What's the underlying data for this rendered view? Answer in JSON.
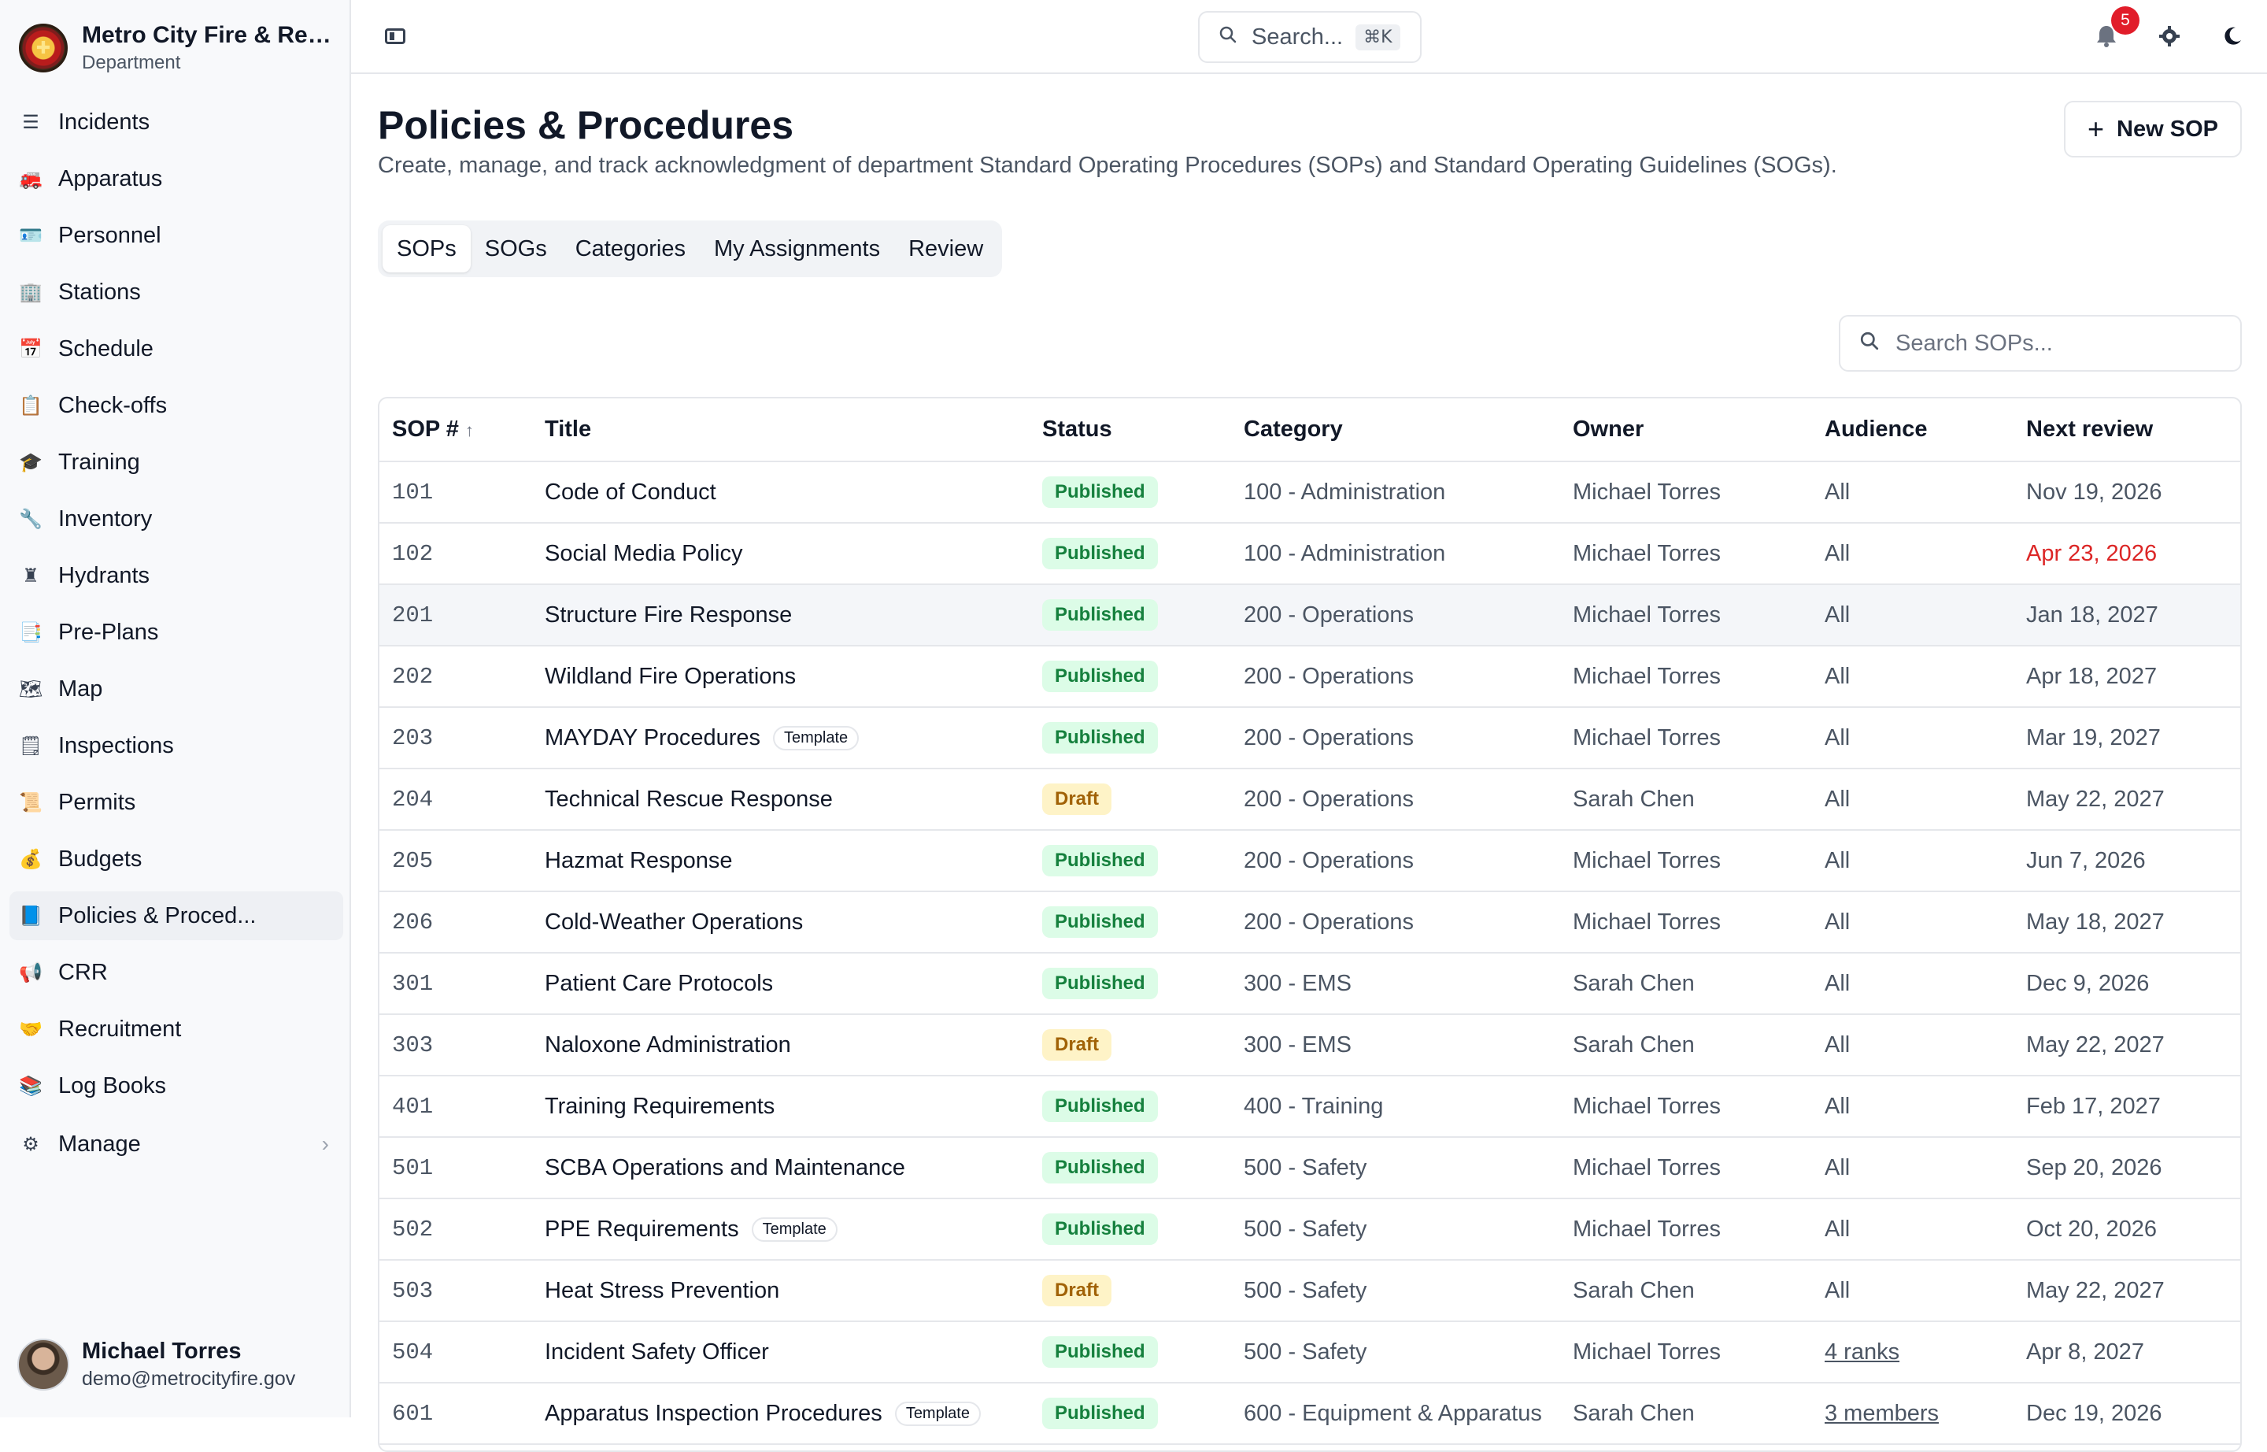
{
  "org": {
    "name": "Metro City Fire & Resc...",
    "subtitle": "Department"
  },
  "nav": [
    {
      "label": "Incidents",
      "icon": "incidents-icon",
      "glyph": "☰"
    },
    {
      "label": "Apparatus",
      "icon": "fire-truck-icon",
      "glyph": "🚒"
    },
    {
      "label": "Personnel",
      "icon": "id-card-icon",
      "glyph": "🪪"
    },
    {
      "label": "Stations",
      "icon": "building-icon",
      "glyph": "🏢"
    },
    {
      "label": "Schedule",
      "icon": "calendar-icon",
      "glyph": "📅"
    },
    {
      "label": "Check-offs",
      "icon": "clipboard-icon",
      "glyph": "📋"
    },
    {
      "label": "Training",
      "icon": "graduation-cap-icon",
      "glyph": "🎓"
    },
    {
      "label": "Inventory",
      "icon": "wrench-icon",
      "glyph": "🔧"
    },
    {
      "label": "Hydrants",
      "icon": "hydrant-icon",
      "glyph": "♜"
    },
    {
      "label": "Pre-Plans",
      "icon": "document-search-icon",
      "glyph": "📑"
    },
    {
      "label": "Map",
      "icon": "map-icon",
      "glyph": "🗺"
    },
    {
      "label": "Inspections",
      "icon": "checklist-icon",
      "glyph": "🗒"
    },
    {
      "label": "Permits",
      "icon": "permit-icon",
      "glyph": "📜"
    },
    {
      "label": "Budgets",
      "icon": "money-bag-icon",
      "glyph": "💰"
    },
    {
      "label": "Policies & Proced...",
      "icon": "book-icon",
      "glyph": "📘"
    },
    {
      "label": "CRR",
      "icon": "megaphone-icon",
      "glyph": "📢"
    },
    {
      "label": "Recruitment",
      "icon": "handshake-icon",
      "glyph": "🤝"
    },
    {
      "label": "Log Books",
      "icon": "books-icon",
      "glyph": "📚"
    }
  ],
  "manage": {
    "label": "Manage",
    "chevron": "›"
  },
  "user": {
    "name": "Michael Torres",
    "email": "demo@metrocityfire.gov"
  },
  "topbar": {
    "search_placeholder": "Search...",
    "search_shortcut": "⌘K",
    "notification_count": "5"
  },
  "page": {
    "title": "Policies & Procedures",
    "description": "Create, manage, and track acknowledgment of department Standard Operating Procedures (SOPs) and Standard Operating Guidelines (SOGs).",
    "new_button": "New SOP"
  },
  "tabs": [
    "SOPs",
    "SOGs",
    "Categories",
    "My Assignments",
    "Review"
  ],
  "table_search_placeholder": "Search SOPs...",
  "table": {
    "headers": {
      "num": "SOP #",
      "title": "Title",
      "status": "Status",
      "category": "Category",
      "owner": "Owner",
      "audience": "Audience",
      "review": "Next review"
    },
    "rows": [
      {
        "num": "101",
        "title": "Code of Conduct",
        "tag": "",
        "status": "Published",
        "category": "100 - Administration",
        "owner": "Michael Torres",
        "audience": "All",
        "review": "Nov 19, 2026",
        "overdue": false
      },
      {
        "num": "102",
        "title": "Social Media Policy",
        "tag": "",
        "status": "Published",
        "category": "100 - Administration",
        "owner": "Michael Torres",
        "audience": "All",
        "review": "Apr 23, 2026",
        "overdue": true
      },
      {
        "num": "201",
        "title": "Structure Fire Response",
        "tag": "",
        "status": "Published",
        "category": "200 - Operations",
        "owner": "Michael Torres",
        "audience": "All",
        "review": "Jan 18, 2027",
        "overdue": false
      },
      {
        "num": "202",
        "title": "Wildland Fire Operations",
        "tag": "",
        "status": "Published",
        "category": "200 - Operations",
        "owner": "Michael Torres",
        "audience": "All",
        "review": "Apr 18, 2027",
        "overdue": false
      },
      {
        "num": "203",
        "title": "MAYDAY Procedures",
        "tag": "Template",
        "status": "Published",
        "category": "200 - Operations",
        "owner": "Michael Torres",
        "audience": "All",
        "review": "Mar 19, 2027",
        "overdue": false
      },
      {
        "num": "204",
        "title": "Technical Rescue Response",
        "tag": "",
        "status": "Draft",
        "category": "200 - Operations",
        "owner": "Sarah Chen",
        "audience": "All",
        "review": "May 22, 2027",
        "overdue": false
      },
      {
        "num": "205",
        "title": "Hazmat Response",
        "tag": "",
        "status": "Published",
        "category": "200 - Operations",
        "owner": "Michael Torres",
        "audience": "All",
        "review": "Jun 7, 2026",
        "overdue": false
      },
      {
        "num": "206",
        "title": "Cold-Weather Operations",
        "tag": "",
        "status": "Published",
        "category": "200 - Operations",
        "owner": "Michael Torres",
        "audience": "All",
        "review": "May 18, 2027",
        "overdue": false
      },
      {
        "num": "301",
        "title": "Patient Care Protocols",
        "tag": "",
        "status": "Published",
        "category": "300 - EMS",
        "owner": "Sarah Chen",
        "audience": "All",
        "review": "Dec 9, 2026",
        "overdue": false
      },
      {
        "num": "303",
        "title": "Naloxone Administration",
        "tag": "",
        "status": "Draft",
        "category": "300 - EMS",
        "owner": "Sarah Chen",
        "audience": "All",
        "review": "May 22, 2027",
        "overdue": false
      },
      {
        "num": "401",
        "title": "Training Requirements",
        "tag": "",
        "status": "Published",
        "category": "400 - Training",
        "owner": "Michael Torres",
        "audience": "All",
        "review": "Feb 17, 2027",
        "overdue": false
      },
      {
        "num": "501",
        "title": "SCBA Operations and Maintenance",
        "tag": "",
        "status": "Published",
        "category": "500 - Safety",
        "owner": "Michael Torres",
        "audience": "All",
        "review": "Sep 20, 2026",
        "overdue": false
      },
      {
        "num": "502",
        "title": "PPE Requirements",
        "tag": "Template",
        "status": "Published",
        "category": "500 - Safety",
        "owner": "Michael Torres",
        "audience": "All",
        "review": "Oct 20, 2026",
        "overdue": false
      },
      {
        "num": "503",
        "title": "Heat Stress Prevention",
        "tag": "",
        "status": "Draft",
        "category": "500 - Safety",
        "owner": "Sarah Chen",
        "audience": "All",
        "review": "May 22, 2027",
        "overdue": false
      },
      {
        "num": "504",
        "title": "Incident Safety Officer",
        "tag": "",
        "status": "Published",
        "category": "500 - Safety",
        "owner": "Michael Torres",
        "audience": "4 ranks",
        "review": "Apr 8, 2027",
        "overdue": false
      },
      {
        "num": "601",
        "title": "Apparatus Inspection Procedures",
        "tag": "Template",
        "status": "Published",
        "category": "600 - Equipment & Apparatus",
        "owner": "Sarah Chen",
        "audience": "3 members",
        "review": "Dec 19, 2026",
        "overdue": false
      }
    ]
  },
  "colors": {
    "published_bg": "#dcfce7",
    "published_text": "#15803d",
    "draft_bg": "#fef3c7",
    "draft_text": "#a16207",
    "overdue": "#dc2626",
    "badge": "#e11d2a",
    "active_nav_icon": "#7c3aed"
  }
}
